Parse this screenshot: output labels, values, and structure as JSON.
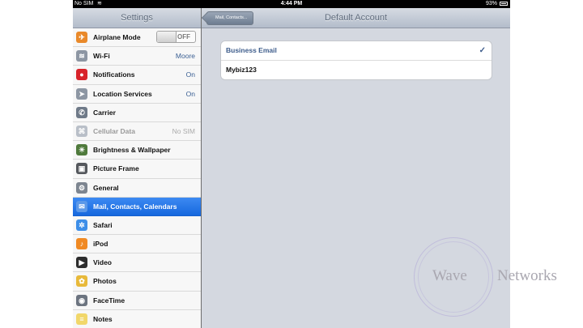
{
  "status_bar": {
    "carrier": "No SIM",
    "wifi_icon": "wifi-icon",
    "time": "4:44 PM",
    "battery": "93%"
  },
  "sidebar": {
    "title": "Settings",
    "items": [
      {
        "label": "Airplane Mode",
        "icon": "airplane-icon",
        "color": "#e9892a",
        "glyph": "✈",
        "toggle": "OFF"
      },
      {
        "label": "Wi-Fi",
        "icon": "wifi-icon",
        "color": "#8d96a3",
        "glyph": "≋",
        "value": "Moore"
      },
      {
        "label": "Notifications",
        "icon": "notifications-icon",
        "color": "#d8232a",
        "glyph": "●",
        "value": "On"
      },
      {
        "label": "Location Services",
        "icon": "location-icon",
        "color": "#8d96a3",
        "glyph": "➤",
        "value": "On"
      },
      {
        "label": "Carrier",
        "icon": "phone-icon",
        "color": "#6f7a88",
        "glyph": "✆"
      },
      {
        "label": "Cellular Data",
        "icon": "cellular-icon",
        "color": "#b9bfc8",
        "glyph": "⌘",
        "value": "No SIM",
        "disabled": true
      },
      {
        "label": "Brightness & Wallpaper",
        "icon": "brightness-icon",
        "color": "#4f7a3c",
        "glyph": "☀"
      },
      {
        "label": "Picture Frame",
        "icon": "picture-frame-icon",
        "color": "#55585d",
        "glyph": "▣"
      },
      {
        "label": "General",
        "icon": "gear-icon",
        "color": "#7d8590",
        "glyph": "⚙"
      },
      {
        "label": "Mail, Contacts, Calendars",
        "icon": "mail-icon",
        "color": "#5b98e8",
        "glyph": "✉",
        "selected": true
      },
      {
        "label": "Safari",
        "icon": "safari-icon",
        "color": "#3d8ee8",
        "glyph": "✲"
      },
      {
        "label": "iPod",
        "icon": "ipod-icon",
        "color": "#f08a24",
        "glyph": "♪"
      },
      {
        "label": "Video",
        "icon": "video-icon",
        "color": "#2d2d2d",
        "glyph": "▶"
      },
      {
        "label": "Photos",
        "icon": "photos-icon",
        "color": "#e8b93a",
        "glyph": "✿"
      },
      {
        "label": "FaceTime",
        "icon": "facetime-icon",
        "color": "#6c7480",
        "glyph": "◉"
      },
      {
        "label": "Notes",
        "icon": "notes-icon",
        "color": "#f1d76a",
        "glyph": "≡"
      }
    ]
  },
  "detail": {
    "title": "Default Account",
    "back_label": "Mail, Contacts...",
    "accounts": [
      {
        "label": "Business Email",
        "checked": true
      },
      {
        "label": "Mybiz123",
        "checked": false
      }
    ]
  },
  "watermark": {
    "left": "Wave",
    "right": "Networks"
  }
}
